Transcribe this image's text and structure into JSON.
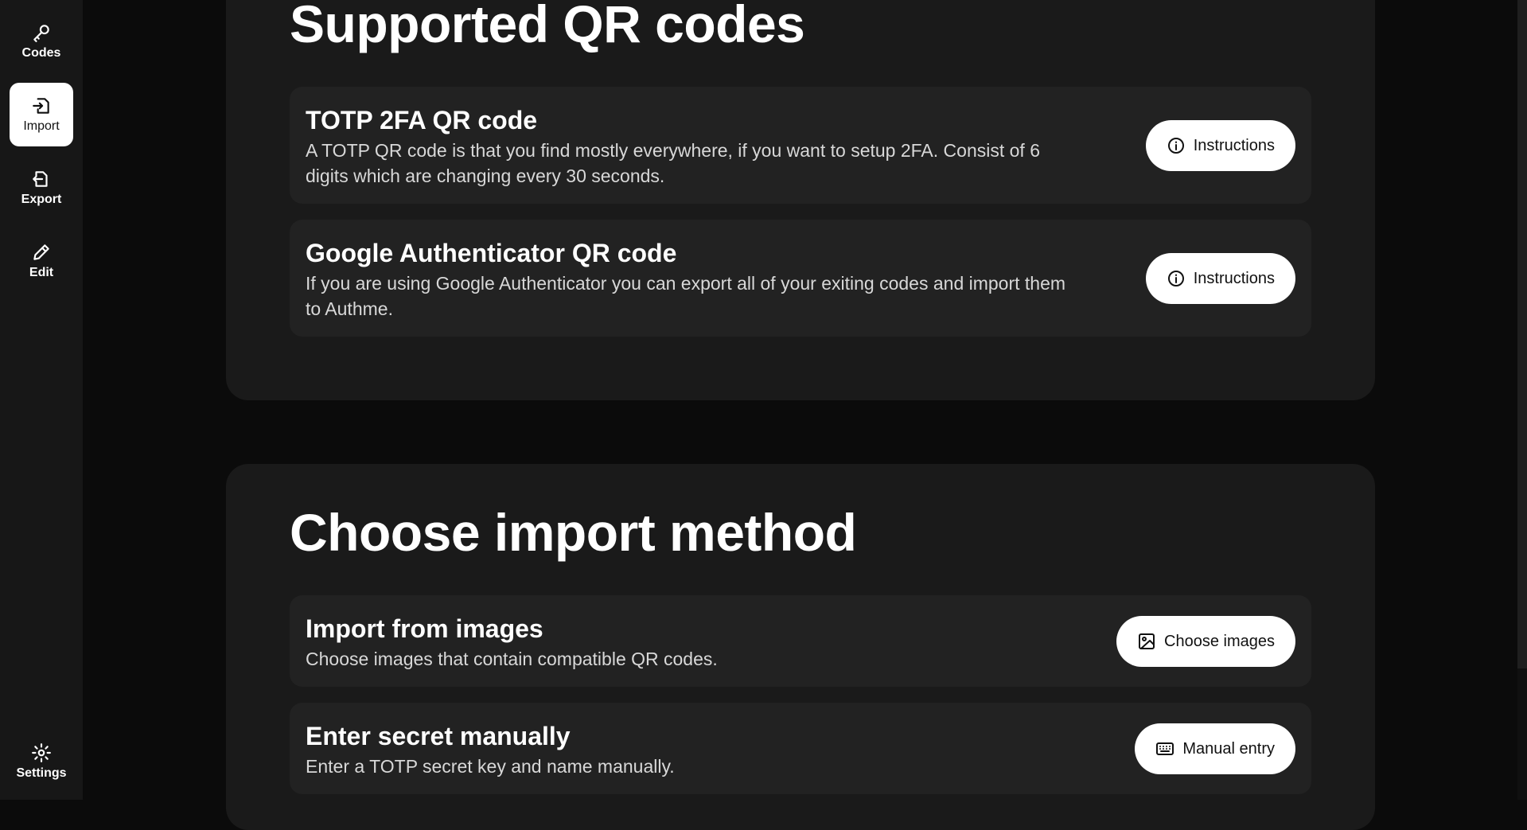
{
  "sidebar": {
    "items": [
      {
        "label": "Codes",
        "icon": "key-icon"
      },
      {
        "label": "Import",
        "icon": "import-icon",
        "active": true
      },
      {
        "label": "Export",
        "icon": "export-icon"
      },
      {
        "label": "Edit",
        "icon": "edit-icon"
      }
    ],
    "settings": {
      "label": "Settings",
      "icon": "gear-icon"
    }
  },
  "supported": {
    "title": "Supported QR codes",
    "items": [
      {
        "title": "TOTP 2FA QR code",
        "description": "A TOTP QR code is that you find mostly everywhere, if you want to setup 2FA. Consist of 6 digits which are changing every 30 seconds.",
        "button": "Instructions"
      },
      {
        "title": "Google Authenticator QR code",
        "description": "If you are using Google Authenticator you can export all of your exiting codes and import them to Authme.",
        "button": "Instructions"
      }
    ]
  },
  "import_methods": {
    "title": "Choose import method",
    "items": [
      {
        "title": "Import from images",
        "description": "Choose images that contain compatible QR codes.",
        "button": "Choose images"
      },
      {
        "title": "Enter secret manually",
        "description": "Enter a TOTP secret key and name manually.",
        "button": "Manual entry"
      }
    ]
  },
  "colors": {
    "background": "#0b0b0b",
    "sidebar": "#171717",
    "card": "#1a1a1a",
    "row": "#222222",
    "button": "#ffffff"
  }
}
